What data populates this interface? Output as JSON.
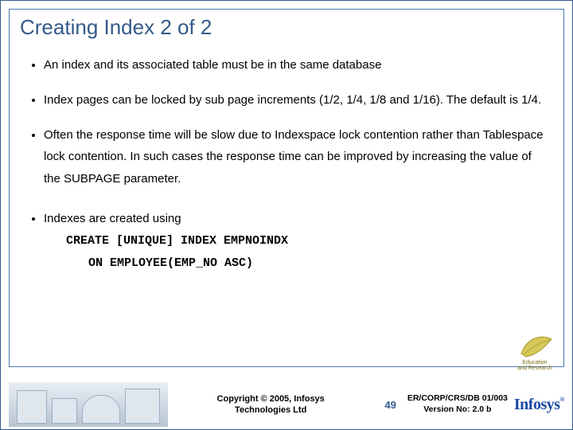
{
  "slide": {
    "title": "Creating Index 2 of 2",
    "bullets": [
      "An index and its associated table must be in the same database",
      "Index pages can be locked by sub page increments (1/2, 1/4, 1/8 and 1/16).  The default is 1/4.",
      "Often the response time will be slow due to Indexspace lock contention rather than Tablespace lock contention.  In such cases the response time can be improved by increasing the value of the SUBPAGE parameter.",
      "Indexes are created using"
    ],
    "code": {
      "line1": "CREATE [UNIQUE] INDEX EMPNOINDX",
      "line2": "ON EMPLOYEE(EMP_NO ASC)"
    }
  },
  "footer": {
    "copyright_line1": "Copyright © 2005, Infosys",
    "copyright_line2": "Technologies Ltd",
    "page_number": "49",
    "docref_line1": "ER/CORP/CRS/DB 01/003",
    "docref_line2": "Version No: 2.0 b",
    "logo_text": "Infosys"
  },
  "badge": {
    "line1": "Education",
    "line2": "and",
    "line3": "Research"
  }
}
